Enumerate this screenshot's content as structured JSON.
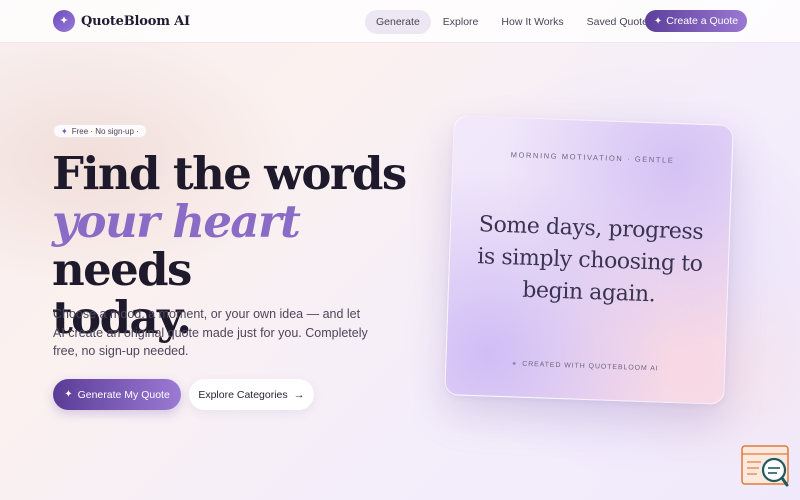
{
  "brand": {
    "name": "QuoteBloom AI",
    "logo_icon": "sparkle-icon"
  },
  "nav": {
    "links": [
      {
        "label": "Generate",
        "active": true
      },
      {
        "label": "Explore",
        "active": false
      },
      {
        "label": "How It Works",
        "active": false
      },
      {
        "label": "Saved Quotes",
        "active": false
      }
    ],
    "cta_label": "Create a Quote"
  },
  "hero": {
    "badge": "Free · No sign-up ·",
    "headline": {
      "line1": "Find the words",
      "accent": "your heart",
      "line2_rest": " needs",
      "line3": "today."
    },
    "subtext": "Choose a mood, a moment, or your own idea — and let AI create an original quote made just for you. Completely free, no sign-up needed.",
    "primary_button": "Generate My Quote",
    "secondary_button": "Explore Categories"
  },
  "quote_card": {
    "tag": "MORNING MOTIVATION · GENTLE",
    "quote": "Some days, progress is simply choosing to begin again.",
    "footer": "CREATED WITH QUOTEBLOOM AI"
  },
  "colors": {
    "accent": "#8a6bc6",
    "brand_dark": "#5a3c97",
    "text": "#1e1a2b"
  }
}
